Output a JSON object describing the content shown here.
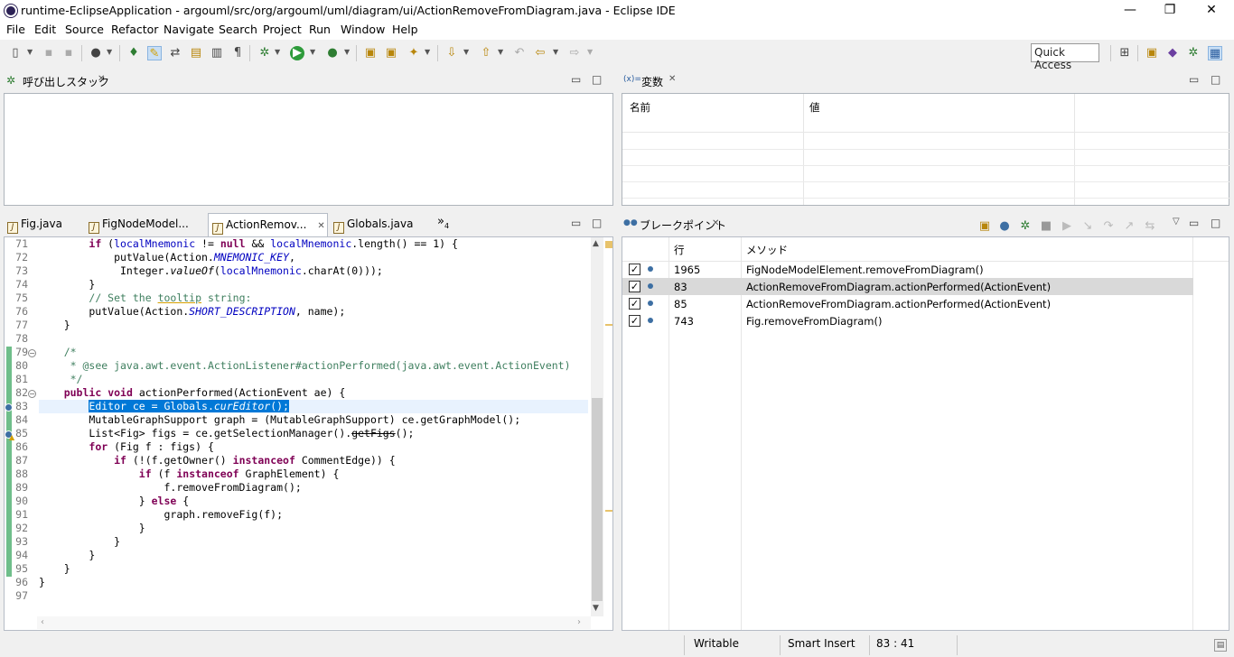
{
  "window": {
    "title": "runtime-EclipseApplication - argouml/src/org/argouml/uml/diagram/ui/ActionRemoveFromDiagram.java - Eclipse IDE",
    "minimize": "—",
    "restore": "❐",
    "close": "✕"
  },
  "menu": [
    "File",
    "Edit",
    "Source",
    "Refactor",
    "Navigate",
    "Search",
    "Project",
    "Run",
    "Window",
    "Help"
  ],
  "quick_access": "Quick Access",
  "callstack": {
    "title": "呼び出しスタック"
  },
  "variables": {
    "title": "変数",
    "prefix": "(x)=",
    "columns": [
      "名前",
      "値"
    ]
  },
  "editor": {
    "tabs": [
      "Fig.java",
      "FigNodeModel...",
      "ActionRemov...",
      "Globals.java"
    ],
    "overflow": "»",
    "overflow_count": "4",
    "line_numbers": [
      "71",
      "72",
      "73",
      "74",
      "75",
      "76",
      "77",
      "78",
      "79",
      "80",
      "81",
      "82",
      "83",
      "84",
      "85",
      "86",
      "87",
      "88",
      "89",
      "90",
      "91",
      "92",
      "93",
      "94",
      "95",
      "96",
      "97"
    ]
  },
  "breakpoints": {
    "title": "ブレークポイント",
    "columns": [
      "行",
      "メソッド"
    ],
    "rows": [
      {
        "line": "1965",
        "method": "FigNodeModelElement.removeFromDiagram()"
      },
      {
        "line": "83",
        "method": "ActionRemoveFromDiagram.actionPerformed(ActionEvent)"
      },
      {
        "line": "85",
        "method": "ActionRemoveFromDiagram.actionPerformed(ActionEvent)"
      },
      {
        "line": "743",
        "method": "Fig.removeFromDiagram()"
      }
    ]
  },
  "status": {
    "writable": "Writable",
    "insert_mode": "Smart Insert",
    "position": "83 : 41"
  },
  "colors": {
    "keyword": "#7f0055",
    "comment": "#3f7f5f",
    "field": "#0000c0",
    "selection": "#0078d7",
    "change_bar": "#6fbe8a"
  }
}
